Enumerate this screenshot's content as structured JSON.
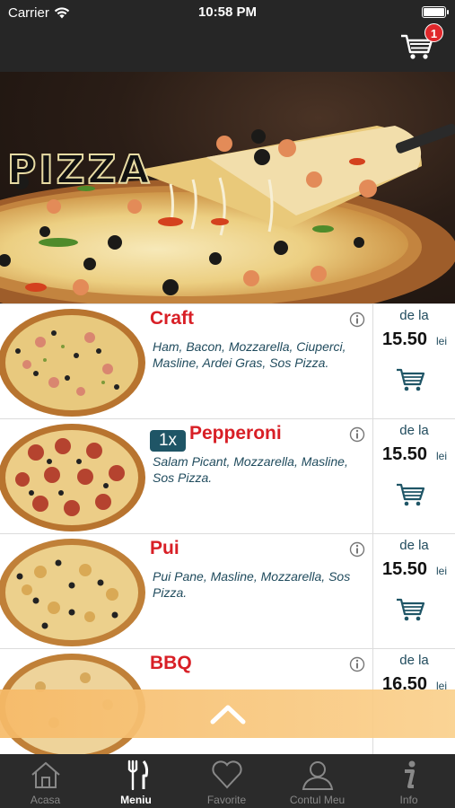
{
  "status_bar": {
    "carrier": "Carrier",
    "time": "10:58 PM"
  },
  "cart": {
    "badge_count": "1"
  },
  "hero": {
    "title": "PIZZA"
  },
  "menu": {
    "items": [
      {
        "name": "Craft",
        "qty": "",
        "description": "Ham, Bacon, Mozzarella, Ciuperci, Masline, Ardei Gras, Sos Pizza.",
        "from_label": "de la",
        "price": "15.50",
        "unit": "lei"
      },
      {
        "name": "Pepperoni",
        "qty": "1x",
        "description": "Salam Picant, Mozzarella, Masline, Sos Pizza.",
        "from_label": "de la",
        "price": "15.50",
        "unit": "lei"
      },
      {
        "name": "Pui",
        "qty": "",
        "description": "Pui Pane, Masline, Mozzarella, Sos Pizza.",
        "from_label": "de la",
        "price": "15.50",
        "unit": "lei"
      },
      {
        "name": "BBQ",
        "qty": "",
        "description": "",
        "from_label": "de la",
        "price": "16.50",
        "unit": "lei"
      }
    ]
  },
  "tabs": [
    {
      "label": "Acasa",
      "icon": "home-icon",
      "active": false
    },
    {
      "label": "Meniu",
      "icon": "fork-knife-icon",
      "active": true
    },
    {
      "label": "Favorite",
      "icon": "heart-icon",
      "active": false
    },
    {
      "label": "Contul Meu",
      "icon": "user-icon",
      "active": false
    },
    {
      "label": "Info",
      "icon": "info-icon",
      "active": false
    }
  ],
  "colors": {
    "accent_red": "#d81f26",
    "text_blue": "#214c5e",
    "bar_dark": "#262626",
    "scroll_banner": "#f7c27a"
  }
}
